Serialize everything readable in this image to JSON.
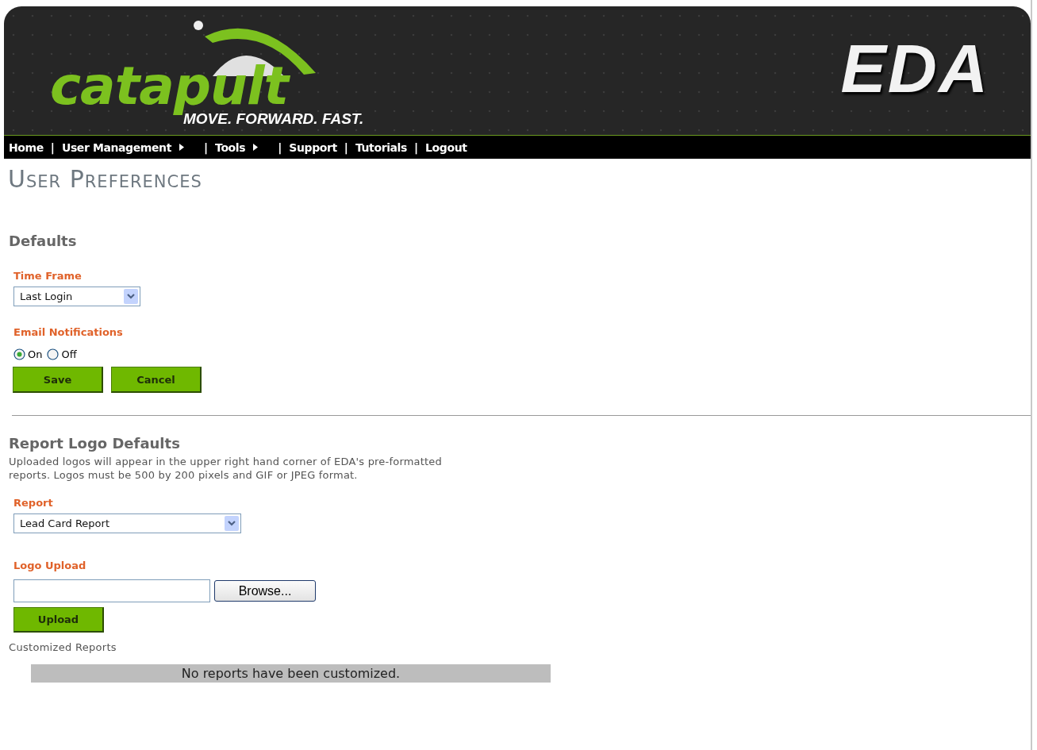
{
  "header": {
    "logo": "catapult",
    "tagline": "MOVE. FORWARD. FAST.",
    "product": "EDA"
  },
  "nav": {
    "separator": "|",
    "items": [
      {
        "label": "Home",
        "submenu": false
      },
      {
        "label": "User Management",
        "submenu": true
      },
      {
        "label": "Tools",
        "submenu": true
      },
      {
        "label": "Support",
        "submenu": false
      },
      {
        "label": "Tutorials",
        "submenu": false
      },
      {
        "label": "Logout",
        "submenu": false
      }
    ]
  },
  "page_title": "User Preferences",
  "defaults": {
    "heading": "Defaults",
    "time_frame": {
      "label": "Time Frame",
      "value": "Last Login"
    },
    "email_notifications": {
      "label": "Email Notifications",
      "options": [
        {
          "label": "On",
          "selected": true
        },
        {
          "label": "Off",
          "selected": false
        }
      ]
    },
    "buttons": [
      "Save",
      "Cancel"
    ]
  },
  "report_logo": {
    "heading": "Report Logo Defaults",
    "description": "Uploaded logos will appear in the upper right hand corner of EDA's pre-formatted reports. Logos must be 500 by 200 pixels and GIF or JPEG format.",
    "report": {
      "label": "Report",
      "value": "Lead Card Report"
    },
    "logo_upload": {
      "label": "Logo Upload",
      "browse": "Browse...",
      "button": "Upload"
    },
    "customized_label": "Customized Reports",
    "empty_message": "No reports have been customized."
  }
}
